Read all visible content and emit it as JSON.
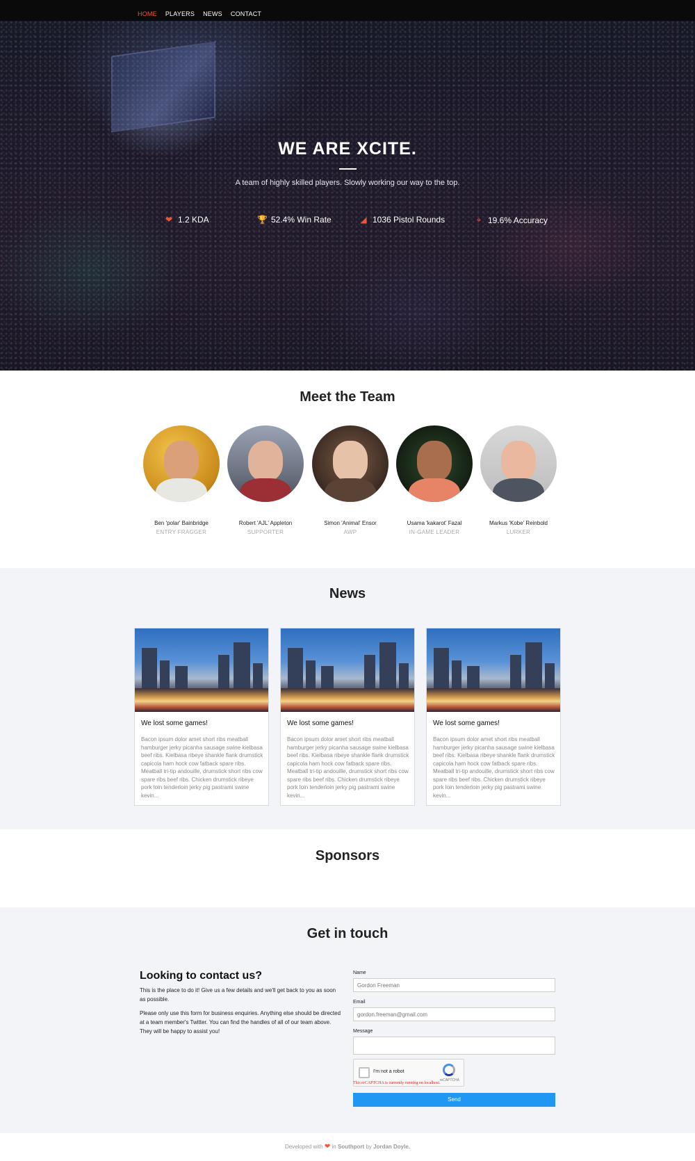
{
  "nav": {
    "items": [
      {
        "label": "HOME",
        "active": true
      },
      {
        "label": "PLAYERS",
        "active": false
      },
      {
        "label": "NEWS",
        "active": false
      },
      {
        "label": "CONTACT",
        "active": false
      }
    ],
    "active_color": "#f0553a"
  },
  "hero": {
    "title": "WE ARE XCITE.",
    "subtitle": "A team of highly skilled players. Slowly working our way to the top.",
    "stats": [
      {
        "icon": "heart-icon",
        "label": "1.2 KDA"
      },
      {
        "icon": "trophy-icon",
        "label": "52.4% Win Rate"
      },
      {
        "icon": "pistol-icon",
        "label": "1036 Pistol Rounds"
      },
      {
        "icon": "crosshair-icon",
        "label": "19.6% Accuracy"
      }
    ]
  },
  "team": {
    "title": "Meet the Team",
    "players": [
      {
        "name": "Ben 'polar' Bainbridge",
        "role": "ENTRY FRAGGER"
      },
      {
        "name": "Robert 'AJL' Appleton",
        "role": "SUPPORTER"
      },
      {
        "name": "Simon 'Animal' Ensor",
        "role": "AWP"
      },
      {
        "name": "Usama 'kakarot' Fazal",
        "role": "IN-GAME LEADER"
      },
      {
        "name": "Markus 'Kobe' Reinbold",
        "role": "LURKER"
      }
    ]
  },
  "news": {
    "title": "News",
    "articles": [
      {
        "title": "We lost some games!",
        "body": "Bacon ipsum dolor amet short ribs meatball hamburger jerky picanha sausage swine kielbasa beef ribs. Kielbasa ribeye shankle flank drumstick capicola ham hock cow fatback spare ribs. Meatball tri-tip andouille, drumstick short ribs cow spare ribs beef ribs. Chicken drumstick ribeye pork loin tenderloin jerky pig pastrami swine kevin..."
      },
      {
        "title": "We lost some games!",
        "body": "Bacon ipsum dolor amet short ribs meatball hamburger jerky picanha sausage swine kielbasa beef ribs. Kielbasa ribeye shankle flank drumstick capicola ham hock cow fatback spare ribs. Meatball tri-tip andouille, drumstick short ribs cow spare ribs beef ribs. Chicken drumstick ribeye pork loin tenderloin jerky pig pastrami swine kevin..."
      },
      {
        "title": "We lost some games!",
        "body": "Bacon ipsum dolor amet short ribs meatball hamburger jerky picanha sausage swine kielbasa beef ribs. Kielbasa ribeye shankle flank drumstick capicola ham hock cow fatback spare ribs. Meatball tri-tip andouille, drumstick short ribs cow spare ribs beef ribs. Chicken drumstick ribeye pork loin tenderloin jerky pig pastrami swine kevin..."
      }
    ]
  },
  "sponsors": {
    "title": "Sponsors"
  },
  "contact": {
    "title": "Get in touch",
    "heading": "Looking to contact us?",
    "para1": "This is the place to do it! Give us a few details and we'll get back to you as soon as possible.",
    "para2": "Please only use this form for business enquiries. Anything else should be directed at a team member's Twitter. You can find the handles of all of our team above. They will be happy to assist you!",
    "form": {
      "name_label": "Name",
      "name_placeholder": "Gordon Freeman",
      "email_label": "Email",
      "email_placeholder": "gordon.freeman@gmail.com",
      "message_label": "Message",
      "captcha_label": "I'm not a robot",
      "captcha_brand": "reCAPTCHA",
      "captcha_warning": "This reCAPTCHA is currently running on localhost.",
      "send_label": "Send"
    },
    "send_color": "#2196f3"
  },
  "footer": {
    "prefix": "Developed with",
    "middle": "in",
    "place": "Southport",
    "by": "by",
    "author": "Jordan Doyle."
  }
}
